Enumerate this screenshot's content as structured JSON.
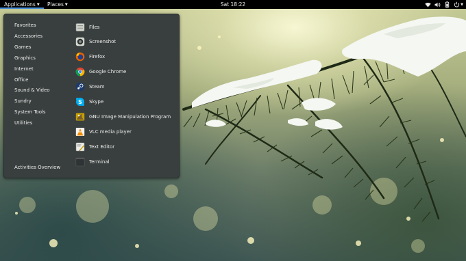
{
  "topbar": {
    "applications_label": "Applications",
    "places_label": "Places",
    "clock": "Sat 18:22"
  },
  "status_icons": [
    "wifi-icon",
    "volume-icon",
    "battery-icon",
    "power-icon"
  ],
  "menu": {
    "categories": [
      {
        "label": "Favorites"
      },
      {
        "label": "Accessories"
      },
      {
        "label": "Games"
      },
      {
        "label": "Graphics"
      },
      {
        "label": "Internet"
      },
      {
        "label": "Office"
      },
      {
        "label": "Sound & Video"
      },
      {
        "label": "Sundry"
      },
      {
        "label": "System Tools"
      },
      {
        "label": "Utilities"
      }
    ],
    "activities_label": "Activities Overview",
    "apps": [
      {
        "label": "Files",
        "icon": "files-icon"
      },
      {
        "label": "Screenshot",
        "icon": "screenshot-icon"
      },
      {
        "label": "Firefox",
        "icon": "firefox-icon"
      },
      {
        "label": "Google Chrome",
        "icon": "chrome-icon"
      },
      {
        "label": "Steam",
        "icon": "steam-icon"
      },
      {
        "label": "Skype",
        "icon": "skype-icon"
      },
      {
        "label": "GNU Image Manipulation Program",
        "icon": "gimp-icon"
      },
      {
        "label": "VLC media player",
        "icon": "vlc-icon"
      },
      {
        "label": "Text Editor",
        "icon": "text-editor-icon"
      },
      {
        "label": "Terminal",
        "icon": "terminal-icon"
      }
    ]
  },
  "colors": {
    "topbar_bg": "#000000",
    "menu_bg": "#393f3f",
    "accent": "#4a90d9",
    "text": "#eeeeec"
  }
}
